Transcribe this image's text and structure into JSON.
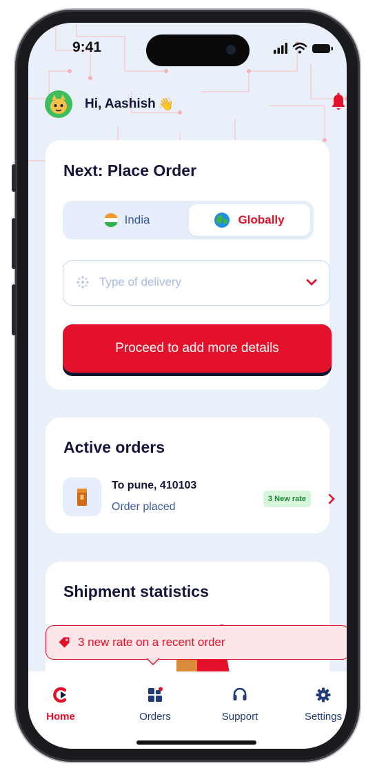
{
  "status_bar": {
    "time": "9:41"
  },
  "header": {
    "greeting": "Hi, Aashish",
    "wave": "👋",
    "icons": [
      "avatar",
      "bell-icon"
    ]
  },
  "place_order": {
    "title": "Next: Place Order",
    "options": [
      {
        "label": "India",
        "icon": "india-flag-icon",
        "selected": false
      },
      {
        "label": "Globally",
        "icon": "globe-icon",
        "selected": true
      }
    ],
    "delivery_placeholder": "Type of delivery",
    "cta_label": "Proceed to add more details"
  },
  "active_orders": {
    "title": "Active orders",
    "orders": [
      {
        "destination": "To pune, 410103",
        "status": "Order placed",
        "badge": "3 New rate"
      }
    ]
  },
  "shipment_statistics": {
    "title": "Shipment statistics"
  },
  "toast": {
    "message": "3 new rate on a recent order"
  },
  "tabs": [
    {
      "label": "Home",
      "icon": "home-icon",
      "active": true
    },
    {
      "label": "Orders",
      "icon": "orders-icon",
      "active": false
    },
    {
      "label": "Support",
      "icon": "headset-icon",
      "active": false
    },
    {
      "label": "Settings",
      "icon": "gear-icon",
      "active": false
    }
  ],
  "colors": {
    "brand": "#e3122a",
    "navy": "#12163a",
    "bg": "#eaf0fa",
    "badge_green": "#d6f6dc"
  }
}
